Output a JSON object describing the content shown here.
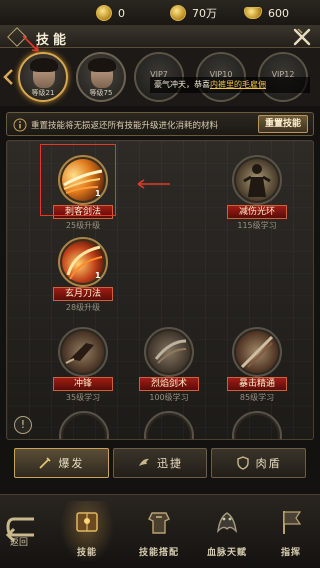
{
  "currency": {
    "gold": "0",
    "silver": "70万",
    "ingot": "600"
  },
  "header": {
    "title": "技能"
  },
  "characters": [
    {
      "level": "等级21"
    },
    {
      "level": "等级75"
    }
  ],
  "vip_slots": [
    "VIP7",
    "VIP10",
    "VIP12"
  ],
  "notice": {
    "prefix": "豪气冲天，恭喜",
    "highlight": "内裤里的毛雇佣"
  },
  "info": {
    "text": "重置技能将无损返还所有技能升级进化消耗的材料",
    "reset_button": "重置技能"
  },
  "skills": [
    {
      "name": "刺客剑法",
      "sub": "25级升级",
      "level": "1",
      "locked": false
    },
    {
      "name": "减伤光环",
      "sub": "115级学习",
      "level": "",
      "locked": true
    },
    {
      "name": "玄月刀法",
      "sub": "28级升级",
      "level": "1",
      "locked": false
    },
    {
      "name": "冲锋",
      "sub": "35级学习",
      "level": "",
      "locked": true
    },
    {
      "name": "烈焰剑术",
      "sub": "100级学习",
      "level": "",
      "locked": true
    },
    {
      "name": "暴击精通",
      "sub": "85级学习",
      "level": "",
      "locked": true
    }
  ],
  "help": "!",
  "tabs": [
    {
      "label": "爆发",
      "icon": "sword-icon",
      "active": true
    },
    {
      "label": "迅捷",
      "icon": "wing-icon",
      "active": false
    },
    {
      "label": "肉盾",
      "icon": "shield-icon",
      "active": false
    }
  ],
  "bottom_nav": {
    "back": "返回",
    "items": [
      {
        "label": "技能",
        "icon": "skill-book-icon",
        "active": true
      },
      {
        "label": "技能搭配",
        "icon": "armor-icon",
        "active": false
      },
      {
        "label": "血脉天赋",
        "icon": "dragon-icon",
        "active": false
      },
      {
        "label": "指挥",
        "icon": "banner-icon",
        "active": false
      }
    ]
  },
  "colors": {
    "accent_gold": "#d7a84f",
    "skill_name_red": "#a11c14",
    "annotation_red": "#e23a2a"
  }
}
